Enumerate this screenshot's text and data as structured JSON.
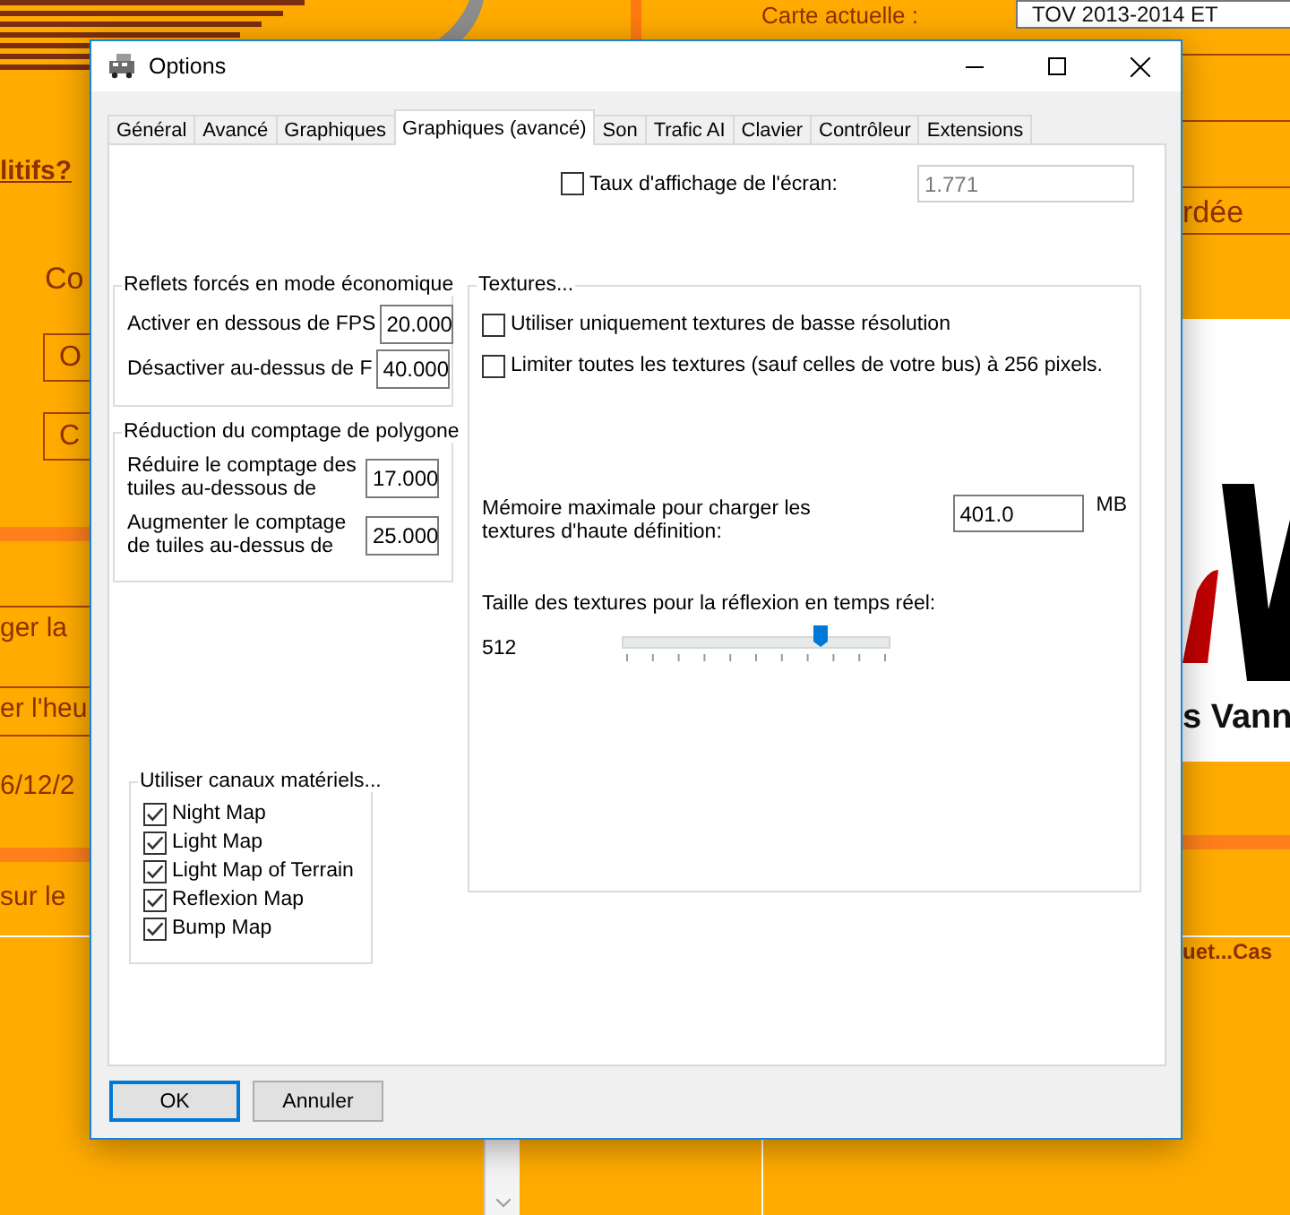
{
  "background": {
    "map_label": "Carte actuelle :",
    "map_value": "TOV 2013-2014 ET",
    "link": "litifs?",
    "heading": "Co",
    "buttons": [
      "O",
      "C"
    ],
    "items": [
      "ger la",
      "er l'heu"
    ],
    "date": "6/12/2",
    "lower_item": "sur le",
    "right_item": "rdée",
    "logo_text": "s Vann",
    "news": "uet...Cas"
  },
  "dialog": {
    "title": "Options",
    "tabs": [
      {
        "label": "Général",
        "selected": false
      },
      {
        "label": "Avancé",
        "selected": false
      },
      {
        "label": "Graphiques",
        "selected": false
      },
      {
        "label": "Graphiques (avancé)",
        "selected": true
      },
      {
        "label": "Son",
        "selected": false
      },
      {
        "label": "Trafic AI",
        "selected": false
      },
      {
        "label": "Clavier",
        "selected": false
      },
      {
        "label": "Contrôleur",
        "selected": false
      },
      {
        "label": "Extensions",
        "selected": false
      }
    ],
    "screen_rate": {
      "label": "Taux d'affichage de l'écran:",
      "checked": false,
      "value": "1.771",
      "disabled": true
    },
    "reflections": {
      "title": "Reflets forcés en mode économique",
      "rows": [
        {
          "label": "Activer en dessous de FPS",
          "value": "20.000"
        },
        {
          "label": "Désactiver au-dessus de F",
          "value": "40.000"
        }
      ]
    },
    "polygons": {
      "title": "Réduction du comptage de polygone",
      "rows": [
        {
          "label": "Réduire le comptage des tuiles au-dessous de",
          "value": "17.000"
        },
        {
          "label": "Augmenter le comptage de tuiles au-dessus de",
          "value": "25.000"
        }
      ]
    },
    "textures": {
      "title": "Textures...",
      "options": [
        {
          "label": "Utiliser uniquement textures de basse résolution",
          "checked": false
        },
        {
          "label": "Limiter toutes les textures (sauf celles de votre bus) à 256 pixels.",
          "checked": false
        }
      ],
      "memory": {
        "label": "Mémoire maximale pour charger les textures d'haute définition:",
        "value": "401.0",
        "unit": "MB"
      },
      "reflection_size": {
        "label": "Taille des textures pour la réflexion en temps réel:",
        "reading": "512",
        "level": 0.74
      }
    },
    "channels": {
      "title": "Utiliser canaux matériels...",
      "items": [
        {
          "label": "Night Map",
          "checked": true
        },
        {
          "label": "Light Map",
          "checked": true
        },
        {
          "label": "Light Map of Terrain",
          "checked": true
        },
        {
          "label": "Reflexion Map",
          "checked": true
        },
        {
          "label": "Bump Map",
          "checked": true
        }
      ]
    },
    "buttons": [
      {
        "label": "OK",
        "default": true
      },
      {
        "label": "Annuler",
        "default": false
      }
    ]
  }
}
